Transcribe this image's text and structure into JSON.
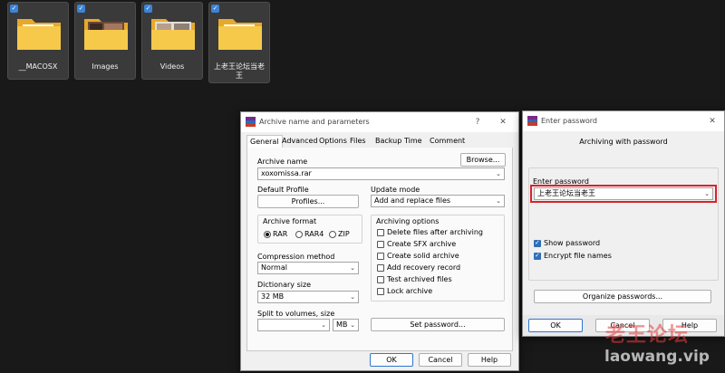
{
  "desktop": {
    "folders": [
      {
        "name": "__MACOSX",
        "selected": true
      },
      {
        "name": "Images",
        "selected": true
      },
      {
        "name": "Videos",
        "selected": true
      },
      {
        "name": "上老王论坛当老王",
        "selected": true
      }
    ]
  },
  "archive_dialog": {
    "title": "Archive name and parameters",
    "help_glyph": "?",
    "close_glyph": "✕",
    "tabs": [
      "General",
      "Advanced",
      "Options",
      "Files",
      "Backup",
      "Time",
      "Comment"
    ],
    "active_tab": "General",
    "archive_name_label": "Archive name",
    "archive_name_value": "xoxomissa.rar",
    "browse_label": "Browse...",
    "default_profile_label": "Default Profile",
    "profiles_label": "Profiles...",
    "update_mode_label": "Update mode",
    "update_mode_value": "Add and replace files",
    "archive_format_label": "Archive format",
    "formats": [
      {
        "label": "RAR",
        "selected": true
      },
      {
        "label": "RAR4",
        "selected": false
      },
      {
        "label": "ZIP",
        "selected": false
      }
    ],
    "archiving_options_label": "Archiving options",
    "options": [
      {
        "label": "Delete files after archiving",
        "checked": false
      },
      {
        "label": "Create SFX archive",
        "checked": false
      },
      {
        "label": "Create solid archive",
        "checked": false
      },
      {
        "label": "Add recovery record",
        "checked": false
      },
      {
        "label": "Test archived files",
        "checked": false
      },
      {
        "label": "Lock archive",
        "checked": false
      }
    ],
    "compression_label": "Compression method",
    "compression_value": "Normal",
    "dictionary_label": "Dictionary size",
    "dictionary_value": "32 MB",
    "split_label": "Split to volumes, size",
    "split_value": "",
    "split_unit": "MB",
    "set_password_label": "Set password...",
    "ok_label": "OK",
    "cancel_label": "Cancel",
    "help_label": "Help"
  },
  "password_dialog": {
    "title": "Enter password",
    "close_glyph": "✕",
    "subtitle": "Archiving with password",
    "enter_password_label": "Enter password",
    "password_value": "上老王论坛当老王",
    "show_password_label": "Show password",
    "show_password_checked": true,
    "encrypt_names_label": "Encrypt file names",
    "encrypt_names_checked": true,
    "organize_label": "Organize passwords...",
    "ok_label": "OK",
    "cancel_label": "Cancel",
    "help_label": "Help",
    "highlight_color": "#d9232a"
  },
  "watermark": {
    "line1": "老王论坛",
    "line2": "laowang.vip"
  },
  "colors": {
    "desktop_bg": "#191919",
    "folder_yellow": "#f7c94a",
    "accent_blue": "#2f77d1"
  }
}
